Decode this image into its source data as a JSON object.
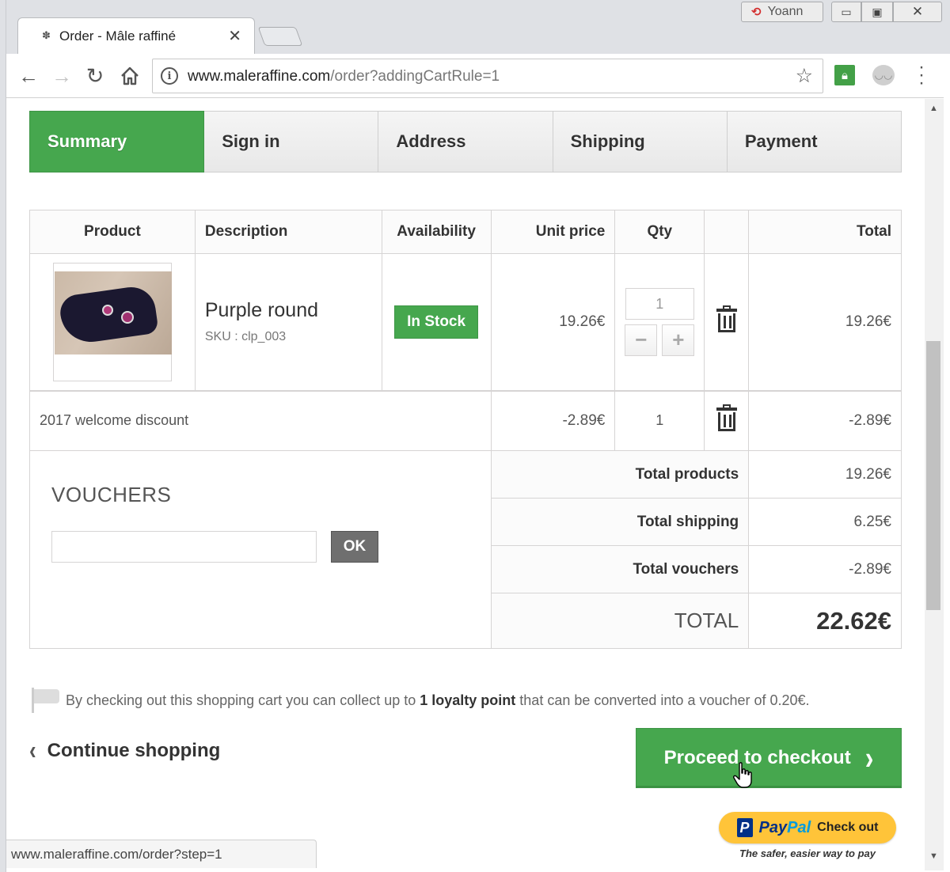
{
  "browser": {
    "tab_title": "Order - Mâle raffiné",
    "tab_favicon": "✽",
    "user_name": "Yoann",
    "url_host": "www.maleraffine.com",
    "url_path": "/order?addingCartRule=1",
    "status_url": "www.maleraffine.com/order?step=1"
  },
  "steps": [
    {
      "label": "Summary",
      "active": true
    },
    {
      "label": "Sign in",
      "active": false
    },
    {
      "label": "Address",
      "active": false
    },
    {
      "label": "Shipping",
      "active": false
    },
    {
      "label": "Payment",
      "active": false
    }
  ],
  "cart": {
    "headers": {
      "product": "Product",
      "description": "Description",
      "availability": "Availability",
      "unit_price": "Unit price",
      "qty": "Qty",
      "delete": "",
      "total": "Total"
    },
    "item": {
      "name": "Purple round",
      "sku": "SKU : clp_003",
      "availability": "In Stock",
      "unit_price": "19.26€",
      "qty": "1",
      "total": "19.26€"
    },
    "discount": {
      "label": "2017 welcome discount",
      "unit_price": "-2.89€",
      "qty": "1",
      "total": "-2.89€"
    },
    "totals": {
      "products_label": "Total products",
      "products_value": "19.26€",
      "shipping_label": "Total shipping",
      "shipping_value": "6.25€",
      "vouchers_label": "Total vouchers",
      "vouchers_value": "-2.89€",
      "grand_label": "TOTAL",
      "grand_value": "22.62€"
    },
    "vouchers": {
      "title": "VOUCHERS",
      "input_value": "",
      "ok_label": "OK"
    }
  },
  "loyalty": {
    "pre": "By checking out this shopping cart you can collect up to ",
    "points": "1 loyalty point",
    "post": " that can be converted into a voucher of 0.20€."
  },
  "actions": {
    "continue_label": "Continue shopping",
    "checkout_label": "Proceed to checkout"
  },
  "paypal": {
    "brand_pay": "Pay",
    "brand_pal": "Pal",
    "check_out": "Check out",
    "tagline": "The safer, easier way to pay"
  },
  "colors": {
    "accent_green": "#46a74e",
    "paypal_yellow": "#ffc439",
    "paypal_blue": "#003087"
  }
}
